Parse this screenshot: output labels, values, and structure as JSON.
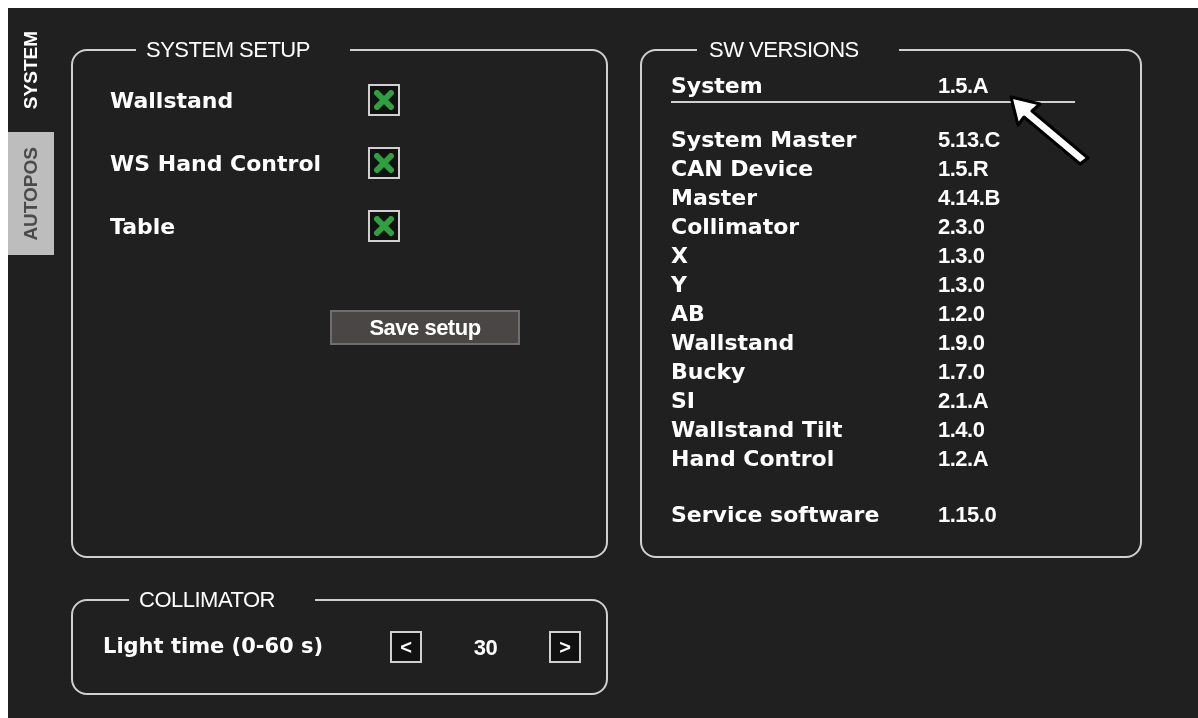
{
  "tabs": [
    {
      "label": "SYSTEM",
      "selected": true
    },
    {
      "label": "AUTOPOS",
      "selected": false
    }
  ],
  "system_setup": {
    "title": "SYSTEM SETUP",
    "items": [
      {
        "label": "Wallstand",
        "checked": true
      },
      {
        "label": "WS Hand Control",
        "checked": true
      },
      {
        "label": "Table",
        "checked": true
      }
    ],
    "save_button": "Save setup"
  },
  "collimator": {
    "title": "COLLIMATOR",
    "light_time": {
      "label": "Light time (0-60 s)",
      "decrement": "<",
      "value": "30",
      "increment": ">"
    }
  },
  "sw_versions": {
    "title": "SW VERSIONS",
    "system": {
      "name": "System",
      "version": "1.5.A"
    },
    "components": [
      {
        "name": "System Master",
        "version": "5.13.C"
      },
      {
        "name": "CAN Device",
        "version": "1.5.R"
      },
      {
        "name": "Master",
        "version": "4.14.B"
      },
      {
        "name": "Collimator",
        "version": "2.3.0"
      },
      {
        "name": "X",
        "version": "1.3.0"
      },
      {
        "name": "Y",
        "version": "1.3.0"
      },
      {
        "name": "AB",
        "version": "1.2.0"
      },
      {
        "name": "Wallstand",
        "version": "1.9.0"
      },
      {
        "name": "Bucky",
        "version": "1.7.0"
      },
      {
        "name": "SI",
        "version": "2.1.A"
      },
      {
        "name": "Wallstand Tilt",
        "version": "1.4.0"
      },
      {
        "name": "Hand Control",
        "version": "1.2.A"
      }
    ],
    "service": {
      "name": "Service software",
      "version": "1.15.0"
    }
  }
}
